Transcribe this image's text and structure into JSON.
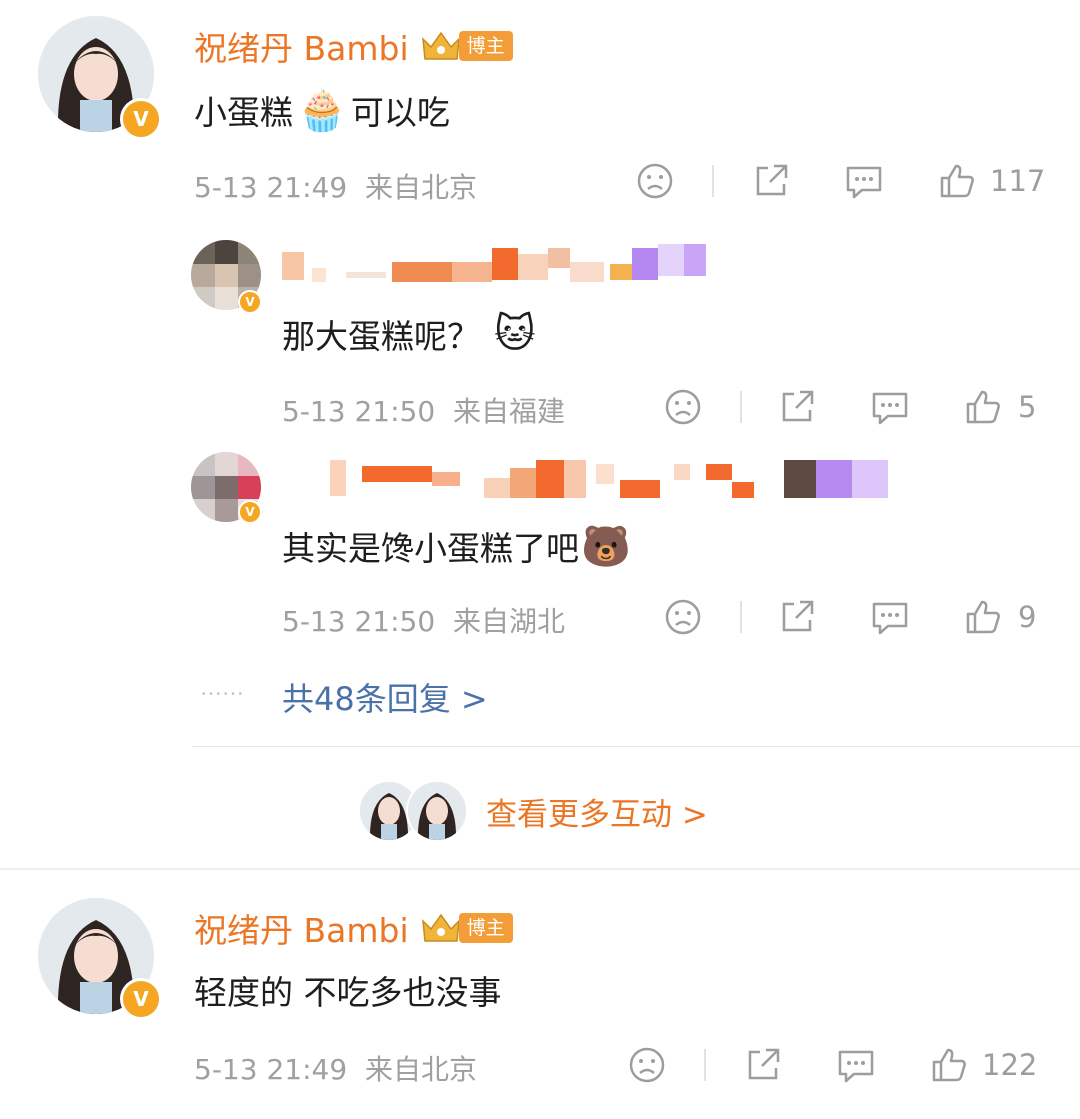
{
  "comments": [
    {
      "author": "祝绪丹 Bambi",
      "badge": "博主",
      "text": "小蛋糕",
      "emoji": "🧁",
      "text_after": "可以吃",
      "date": "5-13 21:49",
      "location": "来自北京",
      "likes": "117"
    },
    {
      "author": "祝绪丹 Bambi",
      "badge": "博主",
      "text": "轻度的 不吃多也没事",
      "date": "5-13 21:49",
      "location": "来自北京",
      "likes": "122"
    }
  ],
  "replies": [
    {
      "text": "那大蛋糕呢？",
      "emoji": "🐱",
      "date": "5-13 21:50",
      "location": "来自福建",
      "likes": "5"
    },
    {
      "text": "其实是馋小蛋糕了吧",
      "emoji": "🐻",
      "date": "5-13 21:50",
      "location": "来自湖北",
      "likes": "9"
    }
  ],
  "dots": "……",
  "reply_count_link": "共48条回复 >",
  "view_more": "查看更多互动 >",
  "icons": [
    "sad-face-icon",
    "share-icon",
    "comment-icon",
    "like-icon",
    "verified-v-icon",
    "crown-icon"
  ],
  "colors": {
    "name": "#eb7626",
    "link": "#4b72a8",
    "meta": "#a0a0a0",
    "badge": "#f29d38"
  }
}
